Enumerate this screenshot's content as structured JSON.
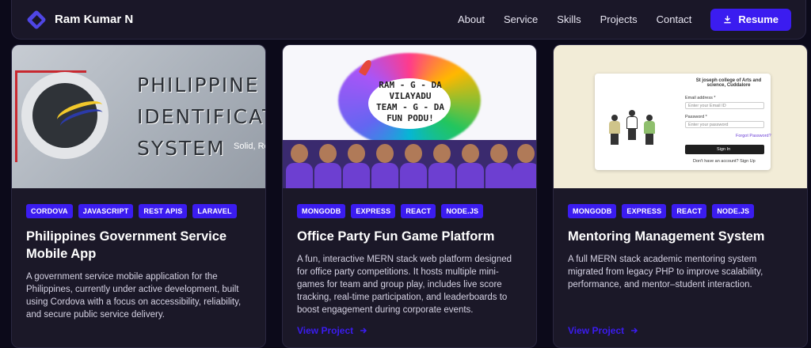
{
  "nav": {
    "brand": "Ram Kumar N",
    "links": [
      "About",
      "Service",
      "Skills",
      "Projects",
      "Contact"
    ],
    "resume_label": "Resume"
  },
  "projects": [
    {
      "image": {
        "lines": [
          "PHILIPPINE",
          "IDENTIFICATI",
          "SYSTEM"
        ],
        "subtext": "Solid, Re"
      },
      "tags": [
        "CORDOVA",
        "JAVASCRIPT",
        "REST APIS",
        "LARAVEL"
      ],
      "title": "Philippines Government Service Mobile App",
      "description": "A government service mobile application for the Philippines, currently under active development, built using Cordova with a focus on accessibility, reliability, and secure public service delivery.",
      "link": ""
    },
    {
      "image": {
        "lines": [
          "RAM - G - DA",
          "VILAYADU",
          "TEAM - G - DA",
          "FUN PODU!"
        ]
      },
      "tags": [
        "MONGODB",
        "EXPRESS",
        "REACT",
        "NODE.JS"
      ],
      "title": "Office Party Fun Game Platform",
      "description": "A fun, interactive MERN stack web platform designed for office party competitions. It hosts multiple mini-games for team and group play, includes live score tracking, real-time participation, and leaderboards to boost engagement during corporate events.",
      "link": "View Project"
    },
    {
      "image": {
        "college": "St joseph college of Arts and science, Cuddalore",
        "email_label": "Email address *",
        "email_placeholder": "Enter your Email ID",
        "password_label": "Password *",
        "password_placeholder": "Enter your password",
        "forgot": "Forgot Password?",
        "signin": "Sign In",
        "signup_prompt": "Don't have an account? Sign Up"
      },
      "tags": [
        "MONGODB",
        "EXPRESS",
        "REACT",
        "NODE.JS"
      ],
      "title": "Mentoring Management System",
      "description": "A full MERN stack academic mentoring system migrated from legacy PHP to improve scalability, performance, and mentor–student interaction.",
      "link": "View Project"
    }
  ],
  "colors": {
    "accent": "#3b1cf0",
    "background": "#0c0a1a",
    "card": "#1b1828"
  }
}
